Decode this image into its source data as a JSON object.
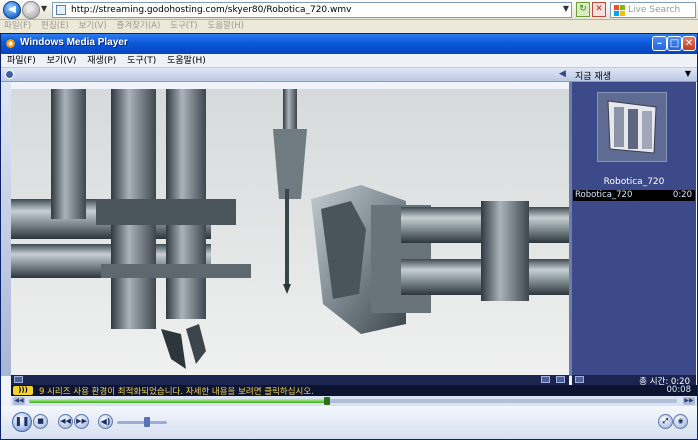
{
  "browser": {
    "address": "http://streaming.godohosting.com/skyer80/Robotica_720.wmv",
    "search_placeholder": "Live Search",
    "menu": [
      "파일(F)",
      "편집(E)",
      "보기(V)",
      "즐겨찾기(A)",
      "도구(T)",
      "도움말(H)"
    ]
  },
  "player": {
    "title": "Windows Media Player",
    "menu": [
      "파일(F)",
      "보기(V)",
      "재생(P)",
      "도구(T)",
      "도움말(H)"
    ],
    "now_playing_label": "지금 재생",
    "playlist": {
      "thumbnail_title": "Robotica_720",
      "items": [
        {
          "name": "Robotica_720",
          "duration": "0:20"
        }
      ]
    },
    "total_time_label": "총 시간: 0:20",
    "status_badge": "",
    "status_message": "9 시리즈 사용 환경이 최적화되었습니다. 자세한 내용을 보려면 클릭하십시오.",
    "elapsed": "00:08",
    "seek_fraction": 0.46,
    "volume_fraction": 0.6
  },
  "colors": {
    "title_bar": "#0b58d9",
    "playlist_bg": "#3c4a8a",
    "status_text": "#f2d34a",
    "seek_fill": "#3fae1c"
  }
}
